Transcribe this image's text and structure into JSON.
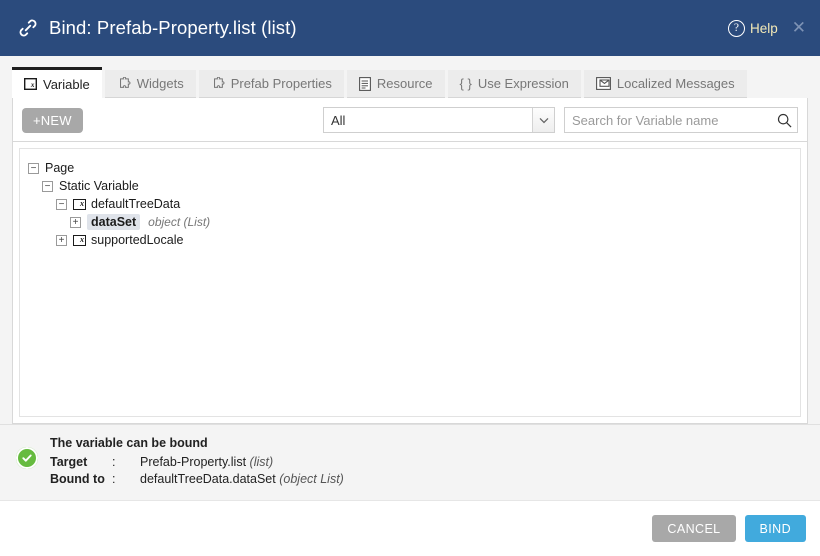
{
  "header": {
    "icon": "link-icon",
    "title": "Bind: Prefab-Property.list (list)",
    "help_label": "Help",
    "help_icon": "question-circle-icon",
    "close_icon": "close-icon",
    "bg_color": "#2b4b7d"
  },
  "tabs": [
    {
      "label": "Variable",
      "icon": "variable-box-icon",
      "active": true
    },
    {
      "label": "Widgets",
      "icon": "puzzle-piece-icon",
      "active": false
    },
    {
      "label": "Prefab Properties",
      "icon": "puzzle-piece-icon",
      "active": false
    },
    {
      "label": "Resource",
      "icon": "document-icon",
      "active": false
    },
    {
      "label": "Use Expression",
      "icon": "curly-braces-icon",
      "active": false
    },
    {
      "label": "Localized Messages",
      "icon": "envelope-box-icon",
      "active": false
    }
  ],
  "toolbar": {
    "new_label": "+NEW",
    "filter_value": "All",
    "filter_options": [
      "All"
    ],
    "search_placeholder": "Search for Variable name",
    "search_value": "",
    "search_icon": "search-icon"
  },
  "tree": [
    {
      "indent": 0,
      "toggle": "minus",
      "icon": null,
      "label": "Page",
      "type": null,
      "selected": false
    },
    {
      "indent": 1,
      "toggle": "minus",
      "icon": null,
      "label": "Static Variable",
      "type": null,
      "selected": false
    },
    {
      "indent": 2,
      "toggle": "minus",
      "icon": "variable-box-icon",
      "label": "defaultTreeData",
      "type": null,
      "selected": false
    },
    {
      "indent": 3,
      "toggle": "plus",
      "icon": null,
      "label": "dataSet",
      "type": "object (List)",
      "selected": true
    },
    {
      "indent": 2,
      "toggle": "plus",
      "icon": "variable-box-icon",
      "label": "supportedLocale",
      "type": null,
      "selected": false
    }
  ],
  "status": {
    "icon": "check-circle-icon",
    "icon_color": "#66bb3f",
    "message": "The variable can be bound",
    "target_key": "Target",
    "colon": ":",
    "target_value": "Prefab-Property.list",
    "target_type": "(list)",
    "bound_key": "Bound to",
    "bound_value": "defaultTreeData.dataSet",
    "bound_type": "(object List)"
  },
  "footer": {
    "cancel_label": "CANCEL",
    "bind_label": "BIND",
    "cancel_color": "#a8a8a8",
    "bind_color": "#41aadd"
  }
}
